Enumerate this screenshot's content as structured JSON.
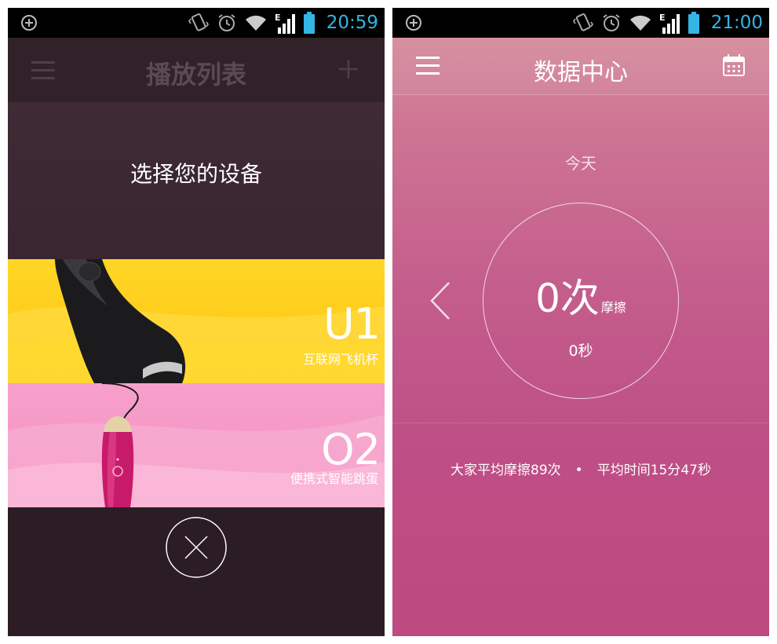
{
  "colors": {
    "status_time": "#33b5e5",
    "left_bg": "#2c1c24",
    "u1_card": "#ffd625",
    "o2_card": "#f48fbf",
    "right_bg": "#c45d8c"
  },
  "left_screen": {
    "status_bar": {
      "time": "20:59",
      "network": "E"
    },
    "header": {
      "title": "播放列表",
      "menu_icon": "hamburger-menu-icon",
      "add_icon": "plus-icon"
    },
    "select_prompt": "选择您的设备",
    "devices": [
      {
        "model": "U1",
        "description": "互联网飞机杯"
      },
      {
        "model": "O2",
        "description": "便携式智能跳蛋"
      }
    ],
    "close_icon": "close-x-icon"
  },
  "right_screen": {
    "status_bar": {
      "time": "21:00",
      "network": "E"
    },
    "header": {
      "title": "数据中心",
      "menu_icon": "hamburger-menu-icon",
      "calendar_icon": "calendar-icon"
    },
    "date_label": "今天",
    "stats": {
      "count": "0次",
      "count_unit": "摩擦",
      "duration": "0秒"
    },
    "average": {
      "count_text": "大家平均摩擦89次",
      "separator": "•",
      "time_text": "平均时间15分47秒"
    }
  }
}
